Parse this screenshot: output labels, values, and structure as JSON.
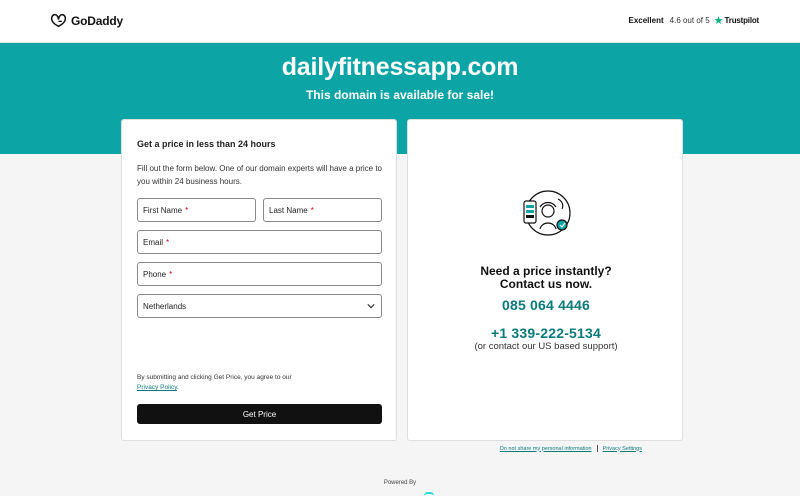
{
  "header": {
    "logo_text": "GoDaddy",
    "rating_label": "Excellent",
    "rating_score": "4.6 out of 5",
    "rating_provider": "Trustpilot"
  },
  "hero": {
    "domain": "dailyfitnessapp.com",
    "tagline": "This domain is available for sale!"
  },
  "form": {
    "title": "Get a price in less than 24 hours",
    "description": "Fill out the form below. One of our domain experts will have a price to you within 24 business hours.",
    "first_name_placeholder": "First Name",
    "last_name_placeholder": "Last Name",
    "email_placeholder": "Email",
    "phone_placeholder": "Phone",
    "required_mark": "*",
    "country_selected": "Netherlands",
    "consent_text": "By submitting and clicking Get Price, you agree to our",
    "privacy_link": "Privacy Policy",
    "consent_end": ".",
    "submit_label": "Get Price"
  },
  "contact": {
    "title_line1": "Need a price instantly?",
    "title_line2": "Contact us now.",
    "phone_local": "085 064 4446",
    "phone_us": "+1 339-222-5134",
    "support_note": "(or contact our US based support)"
  },
  "footer": {
    "do_not_share": "Do not share my personal information",
    "privacy_settings": "Privacy Settings",
    "powered_by": "Powered By"
  },
  "colors": {
    "brand_teal": "#0ca4a5",
    "link_teal": "#0b7a7b",
    "trustpilot_green": "#00b67a",
    "required_red": "#d0021b"
  },
  "icons": {
    "logo": "godaddy-logo-icon",
    "star": "trustpilot-star-icon",
    "select": "chevron-down-icon",
    "illustration": "phone-support-illustration"
  }
}
